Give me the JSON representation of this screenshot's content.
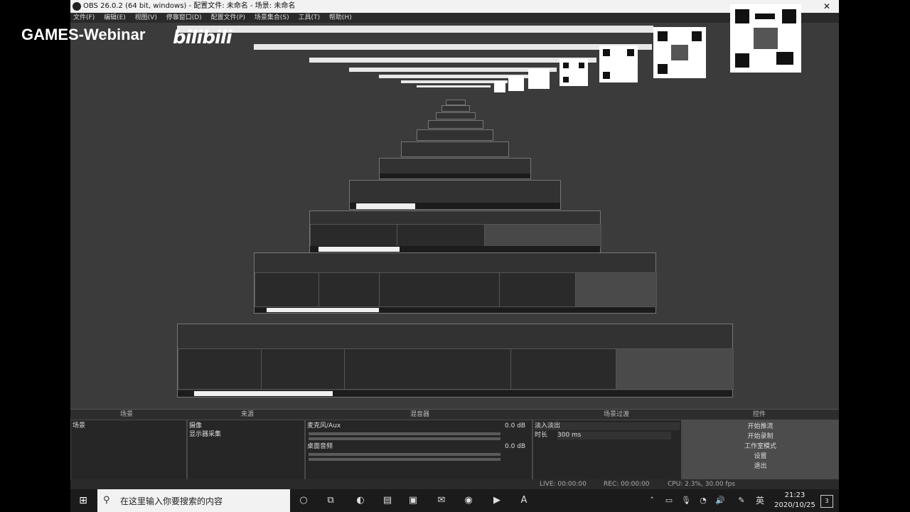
{
  "window": {
    "title": "OBS 26.0.2 (64 bit, windows) - 配置文件: 未命名 - 场景: 未命名",
    "close_glyph": "✕"
  },
  "menu": [
    "文件(F)",
    "编辑(E)",
    "视图(V)",
    "停靠窗口(D)",
    "配置文件(P)",
    "场景集合(S)",
    "工具(T)",
    "帮助(H)"
  ],
  "overlay": {
    "watermark": "GAMES-Webinar",
    "bilibili": "bilibili"
  },
  "docks": {
    "headers": [
      "场景",
      "来源",
      "混音器",
      "场景过渡",
      "控件"
    ],
    "scenes": {
      "items": [
        "场景"
      ]
    },
    "sources": {
      "items": [
        "摄像",
        "显示器采集"
      ]
    },
    "mixer": {
      "channels": [
        {
          "name": "麦克风/Aux",
          "level": "0.0 dB"
        },
        {
          "name": "桌面音频",
          "level": "0.0 dB"
        }
      ]
    },
    "transitions": {
      "type": "淡入淡出",
      "duration_label": "时长",
      "duration": "300 ms"
    },
    "controls": [
      "开始推流",
      "开始录制",
      "工作室模式",
      "设置",
      "退出"
    ]
  },
  "statusbar": {
    "live": "LIVE: 00:00:00",
    "rec": "REC: 00:00:00",
    "cpu": "CPU: 2.3%, 30.00 fps"
  },
  "taskbar": {
    "search_placeholder": "在这里输入你要搜索的内容",
    "input_method": "英",
    "time": "21:23",
    "date": "2020/10/25",
    "notification_count": "3"
  }
}
